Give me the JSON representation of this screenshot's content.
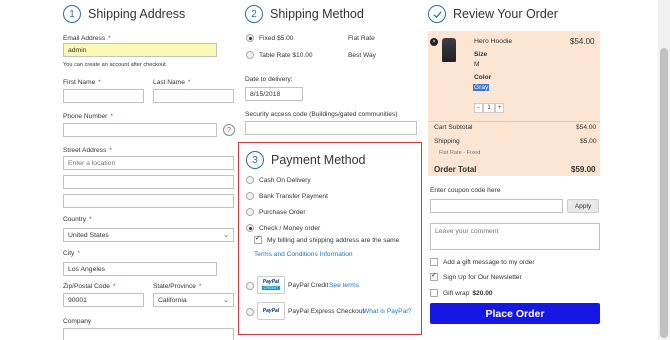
{
  "shipping_address": {
    "step": "1",
    "title": "Shipping Address",
    "email_label": "Email Address",
    "email_value": "admin",
    "email_hint": "You can create an account after checkout.",
    "first_name_label": "First Name",
    "last_name_label": "Last Name",
    "phone_label": "Phone Number",
    "street_label": "Street Address",
    "street_placeholder": "Enter a location",
    "country_label": "Country",
    "country_value": "United States",
    "city_label": "City",
    "city_value": "Los Angeles",
    "zip_label": "Zip/Postal Code",
    "zip_value": "90001",
    "state_label": "State/Province",
    "state_value": "California",
    "company_label": "Company",
    "required_mark": "*",
    "help_mark": "?"
  },
  "shipping_method": {
    "step": "2",
    "title": "Shipping Method",
    "options": [
      {
        "label": "Fixed $5.00",
        "carrier": "Flat Rate",
        "selected": true
      },
      {
        "label": "Table Rate $10.00",
        "carrier": "Best Way",
        "selected": false
      }
    ],
    "date_label": "Date to delivery:",
    "date_value": "8/15/2018",
    "security_label": "Security access code (Buildings/gated communities)"
  },
  "payment_method": {
    "step": "3",
    "title": "Payment Method",
    "options": [
      "Cash On Delivery",
      "Bank Transfer Payment",
      "Purchase Order",
      "Check / Money order"
    ],
    "selected_index": 3,
    "same_address_label": "My billing and shipping address are the same",
    "terms_link": "Terms and Conditions Information",
    "paypal_credit": "PayPal Credit",
    "see_terms": "See terms",
    "paypal_express": "PayPal Express Checkout",
    "what_is_paypal": "What is PayPal?",
    "logo_credit_top": "PayPal",
    "logo_credit_bottom": "CREDIT",
    "logo_paypal": "PayPal"
  },
  "review": {
    "title": "Review Your Order",
    "item_name": "Hero Hoodie",
    "item_price": "$54.00",
    "size_label": "Size",
    "size_value": "M",
    "color_label": "Color",
    "color_value": "Gray",
    "qty_minus": "-",
    "qty_value": "1",
    "qty_plus": "+",
    "remove_mark": "×",
    "cart_subtotal_label": "Cart Subtotal",
    "cart_subtotal_value": "$54.00",
    "shipping_label": "Shipping",
    "shipping_value": "$5.00",
    "shipping_method_text": "Flat Rate - Fixed",
    "order_total_label": "Order Total",
    "order_total_value": "$59.00",
    "coupon_label": "Enter coupon code here",
    "apply_label": "Apply",
    "comment_placeholder": "Leave your comment",
    "gift_message_label": "Add a gift message to my order",
    "newsletter_label": "Sign Up for Our Newsletter",
    "gift_wrap_label": "Gift wrap",
    "gift_wrap_price": "$20.00",
    "place_order_label": "Place Order"
  },
  "colors": {
    "accent": "#1616e6",
    "link": "#1979c3",
    "step_circle": "#2b6ea3",
    "payment_border": "#d23a3a",
    "summary_bg": "#fce6d3",
    "email_bg": "#fafab4"
  }
}
